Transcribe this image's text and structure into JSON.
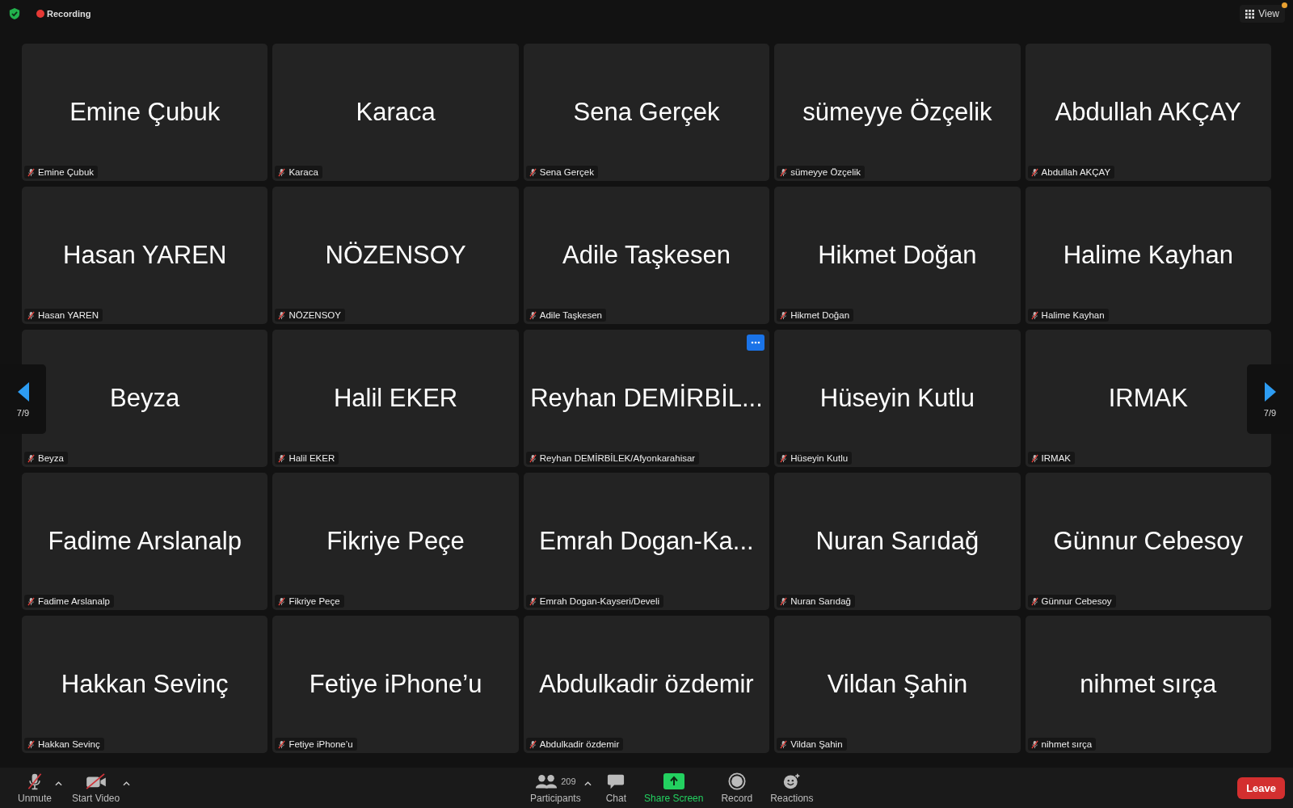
{
  "top_bar": {
    "recording_label": "Recording",
    "view_button": {
      "label": "View",
      "notification": true
    }
  },
  "page_indicator": {
    "left": "7/9",
    "right": "7/9"
  },
  "tiles": [
    {
      "display_name": "Emine Çubuk",
      "label": "Emine Çubuk",
      "muted": true,
      "menu_shown": false
    },
    {
      "display_name": "Karaca",
      "label": "Karaca",
      "muted": true,
      "menu_shown": false
    },
    {
      "display_name": "Sena Gerçek",
      "label": "Sena Gerçek",
      "muted": true,
      "menu_shown": false
    },
    {
      "display_name": "sümeyye Özçelik",
      "label": "sümeyye Özçelik",
      "muted": true,
      "menu_shown": false
    },
    {
      "display_name": "Abdullah AKÇAY",
      "label": "Abdullah AKÇAY",
      "muted": true,
      "menu_shown": false
    },
    {
      "display_name": "Hasan YAREN",
      "label": "Hasan YAREN",
      "muted": true,
      "menu_shown": false
    },
    {
      "display_name": "NÖZENSOY",
      "label": "NÖZENSOY",
      "muted": true,
      "menu_shown": false
    },
    {
      "display_name": "Adile Taşkesen",
      "label": "Adile Taşkesen",
      "muted": true,
      "menu_shown": false
    },
    {
      "display_name": "Hikmet Doğan",
      "label": "Hikmet Doğan",
      "muted": true,
      "menu_shown": false
    },
    {
      "display_name": "Halime Kayhan",
      "label": "Halime Kayhan",
      "muted": true,
      "menu_shown": false
    },
    {
      "display_name": "Beyza",
      "label": "Beyza",
      "muted": true,
      "menu_shown": false
    },
    {
      "display_name": "Halil EKER",
      "label": "Halil EKER",
      "muted": true,
      "menu_shown": false
    },
    {
      "display_name": "Reyhan DEMİRBİL...",
      "label": "Reyhan DEMİRBİLEK/Afyonkarahisar",
      "muted": true,
      "menu_shown": true
    },
    {
      "display_name": "Hüseyin Kutlu",
      "label": "Hüseyin Kutlu",
      "muted": true,
      "menu_shown": false
    },
    {
      "display_name": "IRMAK",
      "label": "IRMAK",
      "muted": true,
      "menu_shown": false
    },
    {
      "display_name": "Fadime Arslanalp",
      "label": "Fadime Arslanalp",
      "muted": true,
      "menu_shown": false
    },
    {
      "display_name": "Fikriye Peçe",
      "label": "Fikriye Peçe",
      "muted": true,
      "menu_shown": false
    },
    {
      "display_name": "Emrah Dogan-Ka...",
      "label": "Emrah Dogan-Kayseri/Develi",
      "muted": true,
      "menu_shown": false
    },
    {
      "display_name": "Nuran Sarıdağ",
      "label": "Nuran Sarıdağ",
      "muted": true,
      "menu_shown": false
    },
    {
      "display_name": "Günnur Cebesoy",
      "label": "Günnur Cebesoy",
      "muted": true,
      "menu_shown": false
    },
    {
      "display_name": "Hakkan Sevinç",
      "label": "Hakkan Sevinç",
      "muted": true,
      "menu_shown": false
    },
    {
      "display_name": "Fetiye iPhone’u",
      "label": "Fetiye iPhone’u",
      "muted": true,
      "menu_shown": false
    },
    {
      "display_name": "Abdulkadir özdemir",
      "label": "Abdulkadir özdemir",
      "muted": true,
      "menu_shown": false
    },
    {
      "display_name": "Vildan Şahin",
      "label": "Vildan Şahin",
      "muted": true,
      "menu_shown": false
    },
    {
      "display_name": "nihmet sırça",
      "label": "nihmet sırça",
      "muted": true,
      "menu_shown": false
    }
  ],
  "toolbar": {
    "left": [
      {
        "kind": "mic",
        "label": "Unmute",
        "off": true,
        "caret": true
      },
      {
        "kind": "video",
        "label": "Start Video",
        "off": true,
        "caret": true
      }
    ],
    "center": [
      {
        "kind": "participants",
        "label": "Participants",
        "count": "209",
        "caret": true
      },
      {
        "kind": "chat",
        "label": "Chat",
        "caret": false
      },
      {
        "kind": "share",
        "label": "Share Screen",
        "caret": false
      },
      {
        "kind": "record",
        "label": "Record",
        "caret": false
      },
      {
        "kind": "reactions",
        "label": "Reactions",
        "caret": false
      }
    ],
    "leave_button": "Leave"
  }
}
